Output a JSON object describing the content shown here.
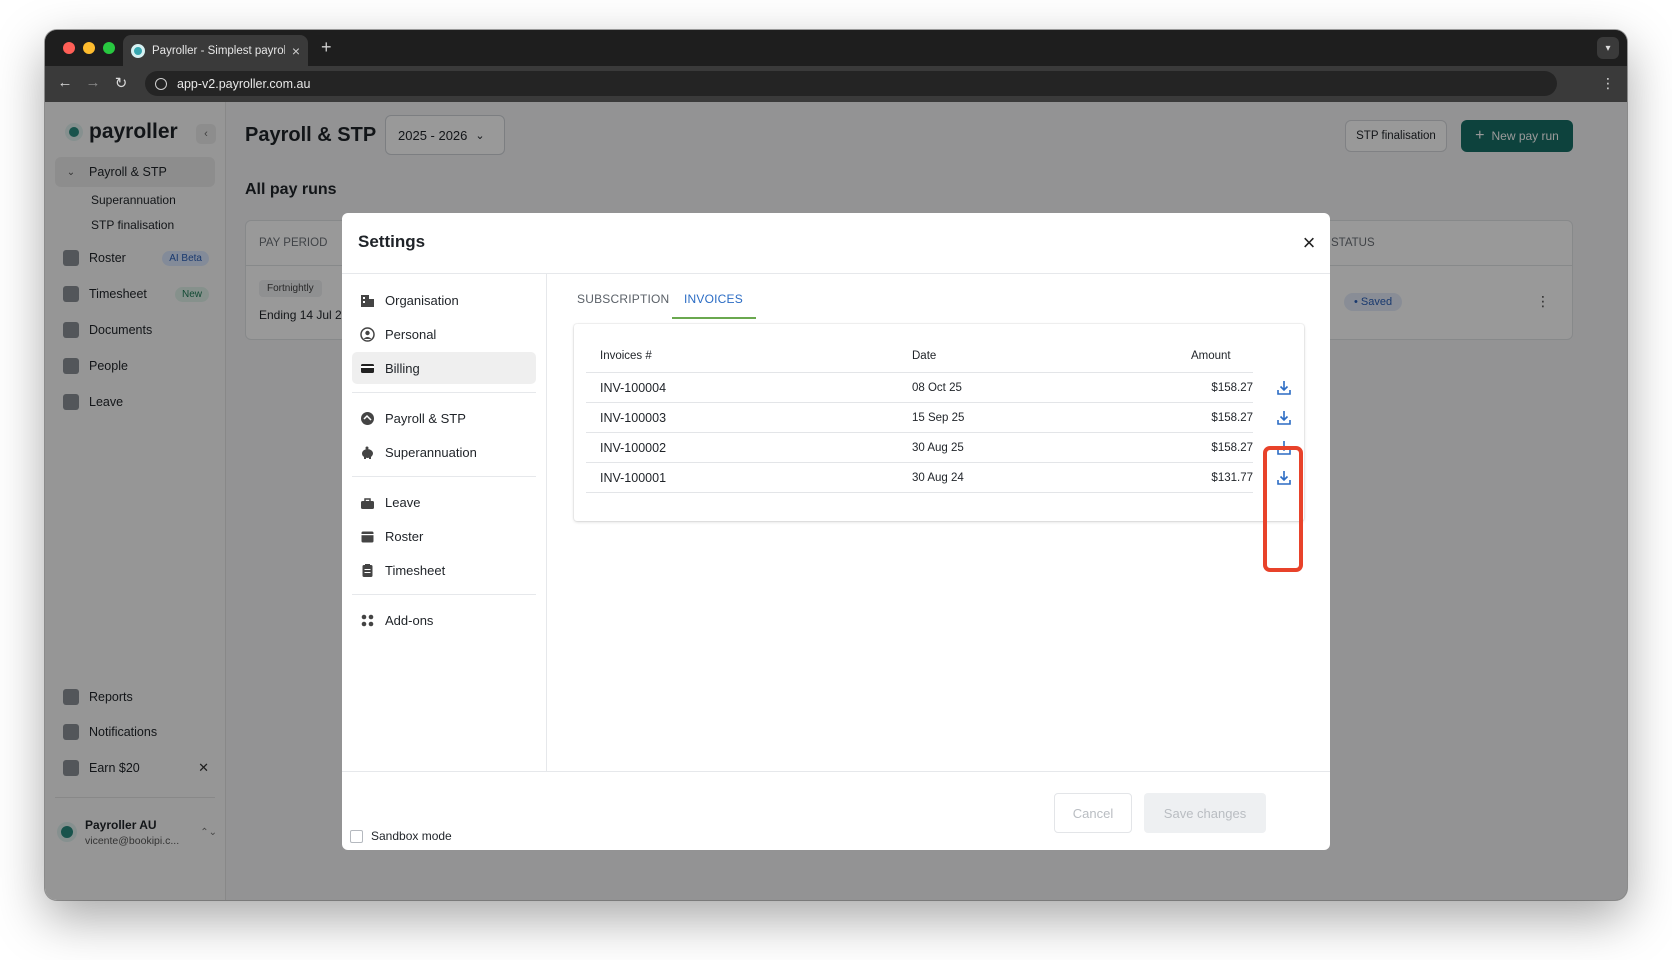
{
  "browser": {
    "tab_title": "Payroller - Simplest payroll so",
    "url": "app-v2.payroller.com.au"
  },
  "sidebar": {
    "logo": "payroller",
    "active_section": "Payroll & STP",
    "sub_items": [
      "Superannuation",
      "STP finalisation"
    ],
    "items": [
      {
        "label": "Roster",
        "badge": "AI Beta",
        "icon": "roster-icon"
      },
      {
        "label": "Timesheet",
        "badge": "New",
        "icon": "timesheet-icon"
      },
      {
        "label": "Documents",
        "icon": "documents-icon"
      },
      {
        "label": "People",
        "icon": "people-icon"
      },
      {
        "label": "Leave",
        "icon": "leave-icon"
      }
    ],
    "bottom_items": [
      {
        "label": "Reports",
        "icon": "reports-icon"
      },
      {
        "label": "Notifications",
        "icon": "bell-icon"
      },
      {
        "label": "Earn $20",
        "icon": "gift-icon"
      }
    ],
    "account": {
      "name": "Payroller AU",
      "email": "vicente@bookipi.c..."
    }
  },
  "main": {
    "title": "Payroll & STP",
    "year": "2025 - 2026",
    "stp_button": "STP finalisation",
    "new_pay_run_button": "New pay run",
    "subheading": "All pay runs",
    "table": {
      "col_pay_period": "PAY PERIOD",
      "col_status": "STATUS",
      "frequency": "Fortnightly",
      "period": "Ending 14 Jul 2",
      "status": "Saved"
    }
  },
  "modal": {
    "title": "Settings",
    "nav": {
      "group1": [
        {
          "label": "Organisation",
          "icon": "building-icon"
        },
        {
          "label": "Personal",
          "icon": "user-circle-icon"
        },
        {
          "label": "Billing",
          "icon": "card-icon"
        }
      ],
      "group2": [
        {
          "label": "Payroll & STP",
          "icon": "payroll-icon"
        },
        {
          "label": "Superannuation",
          "icon": "piggy-bank-icon"
        }
      ],
      "group3": [
        {
          "label": "Leave",
          "icon": "leave-icon"
        },
        {
          "label": "Roster",
          "icon": "calendar-icon"
        },
        {
          "label": "Timesheet",
          "icon": "clipboard-icon"
        }
      ],
      "group4": [
        {
          "label": "Add-ons",
          "icon": "addons-icon"
        }
      ],
      "active": "Billing"
    },
    "tabs": [
      {
        "label": "SUBSCRIPTION",
        "active": false
      },
      {
        "label": "INVOICES",
        "active": true
      }
    ],
    "invoices": {
      "headers": {
        "number": "Invoices #",
        "date": "Date",
        "amount": "Amount"
      },
      "rows": [
        {
          "number": "INV-100004",
          "date": "08 Oct 25",
          "amount": "$158.27"
        },
        {
          "number": "INV-100003",
          "date": "15 Sep 25",
          "amount": "$158.27"
        },
        {
          "number": "INV-100002",
          "date": "30 Aug 25",
          "amount": "$158.27"
        },
        {
          "number": "INV-100001",
          "date": "30 Aug 24",
          "amount": "$131.77"
        }
      ]
    },
    "sandbox_label": "Sandbox mode",
    "cancel_label": "Cancel",
    "save_label": "Save changes"
  },
  "colors": {
    "accent_green": "#176f66",
    "link_blue": "#2b6cc4",
    "highlight_red": "#e8422a"
  }
}
